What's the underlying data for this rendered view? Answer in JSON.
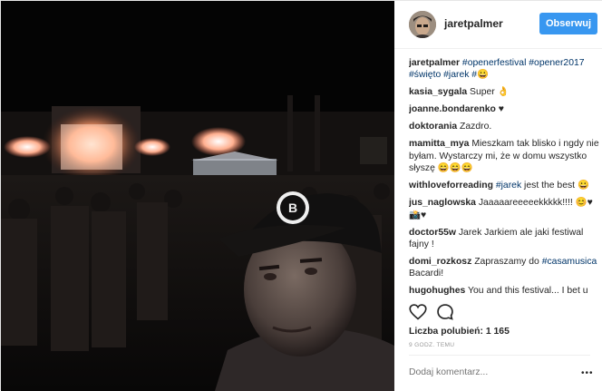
{
  "post": {
    "username": "jaretpalmer",
    "follow_label": "Obserwuj",
    "likes_text": "Liczba polubień: 1 165",
    "timestamp": "9 GODZ. TEMU",
    "add_comment_placeholder": "Dodaj komentarz...",
    "more_label": "•••"
  },
  "caption": {
    "username": "jaretpalmer",
    "text": "#openerfestival #opener2017 #święto #jarek #😀"
  },
  "comments": [
    {
      "user": "kasia_sygala",
      "text": "Super 👌"
    },
    {
      "user": "joanne.bondarenko",
      "text": "♥"
    },
    {
      "user": "doktorania",
      "text": "Zazdro."
    },
    {
      "user": "mamitta_mya",
      "text": "Mieszkam tak blisko i ngdy nie byłam. Wystarczy mi, że w domu wszystko słyszę 😄😄😄"
    },
    {
      "user": "withloveforreading",
      "tag": "#jarek",
      "text": " jest the best 😀"
    },
    {
      "user": "jus_naglowska",
      "text": "Jaaaaareeeeekkkkk!!!! 😊♥📸♥"
    },
    {
      "user": "doctor55w",
      "text": "Jarek Jarkiem ale jaki festiwal fajny !"
    },
    {
      "user": "domi_rozkosz",
      "text": "Zapraszamy do ",
      "tag": "#casamusica",
      "text2": " Bacardi!"
    },
    {
      "user": "hugohughes",
      "text": "You and this festival... I bet u haven't lost one since they invented it"
    }
  ],
  "colors": {
    "follow_button": "#3897f0",
    "hashtag": "#003569",
    "text": "#262626",
    "muted": "#999999"
  },
  "icons": [
    "heart-icon",
    "comment-icon",
    "more-options-icon"
  ]
}
